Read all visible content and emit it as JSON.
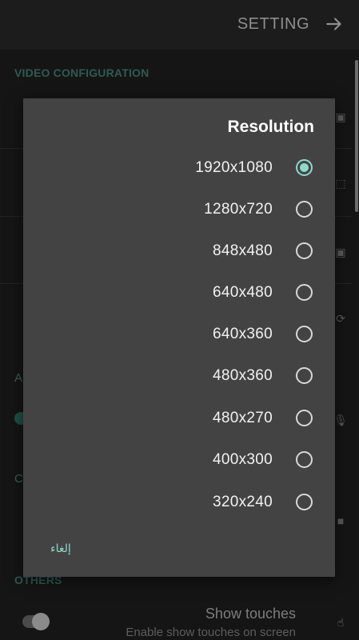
{
  "appbar": {
    "title": "SETTING",
    "back_icon": "arrow-right-icon"
  },
  "sections": {
    "video": "VIDEO CONFIGURATION",
    "others": "OTHERS"
  },
  "background_fragments": {
    "audio": "A",
    "camera": "C"
  },
  "show_touches": {
    "title": "Show touches",
    "subtitle": "Enable show touches on screen"
  },
  "dialog": {
    "title": "Resolution",
    "options": [
      {
        "label": "1920x1080",
        "checked": true
      },
      {
        "label": "1280x720",
        "checked": false
      },
      {
        "label": "848x480",
        "checked": false
      },
      {
        "label": "640x480",
        "checked": false
      },
      {
        "label": "640x360",
        "checked": false
      },
      {
        "label": "480x360",
        "checked": false
      },
      {
        "label": "480x270",
        "checked": false
      },
      {
        "label": "400x300",
        "checked": false
      },
      {
        "label": "320x240",
        "checked": false
      }
    ],
    "cancel_label": "إلغاء"
  },
  "colors": {
    "accent": "#8fd8cc",
    "dialog_bg": "#434343",
    "screen_bg": "#151515"
  }
}
